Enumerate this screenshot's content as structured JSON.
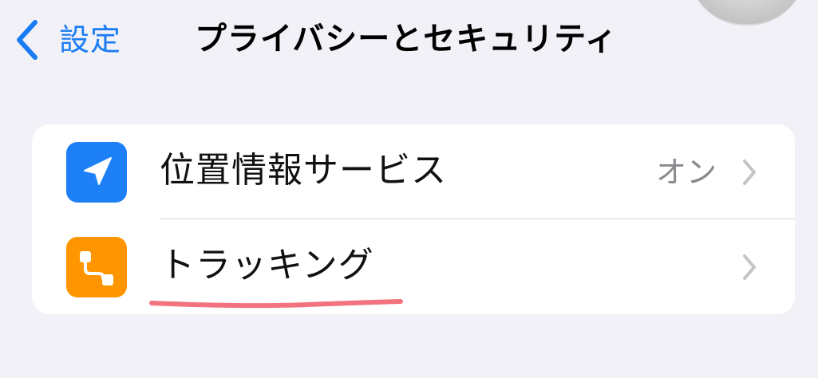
{
  "nav": {
    "back_label": "設定",
    "title": "プライバシーとセキュリティ"
  },
  "settings": {
    "rows": [
      {
        "label": "位置情報サービス",
        "value": "オン",
        "icon": "location-arrow-icon",
        "icon_color": "#1e80f6"
      },
      {
        "label": "トラッキング",
        "value": "",
        "icon": "tracking-icon",
        "icon_color": "#ff9500"
      }
    ]
  },
  "colors": {
    "accent": "#1a7cf5",
    "background": "#f2f1f7",
    "annotation": "#f2727e"
  }
}
